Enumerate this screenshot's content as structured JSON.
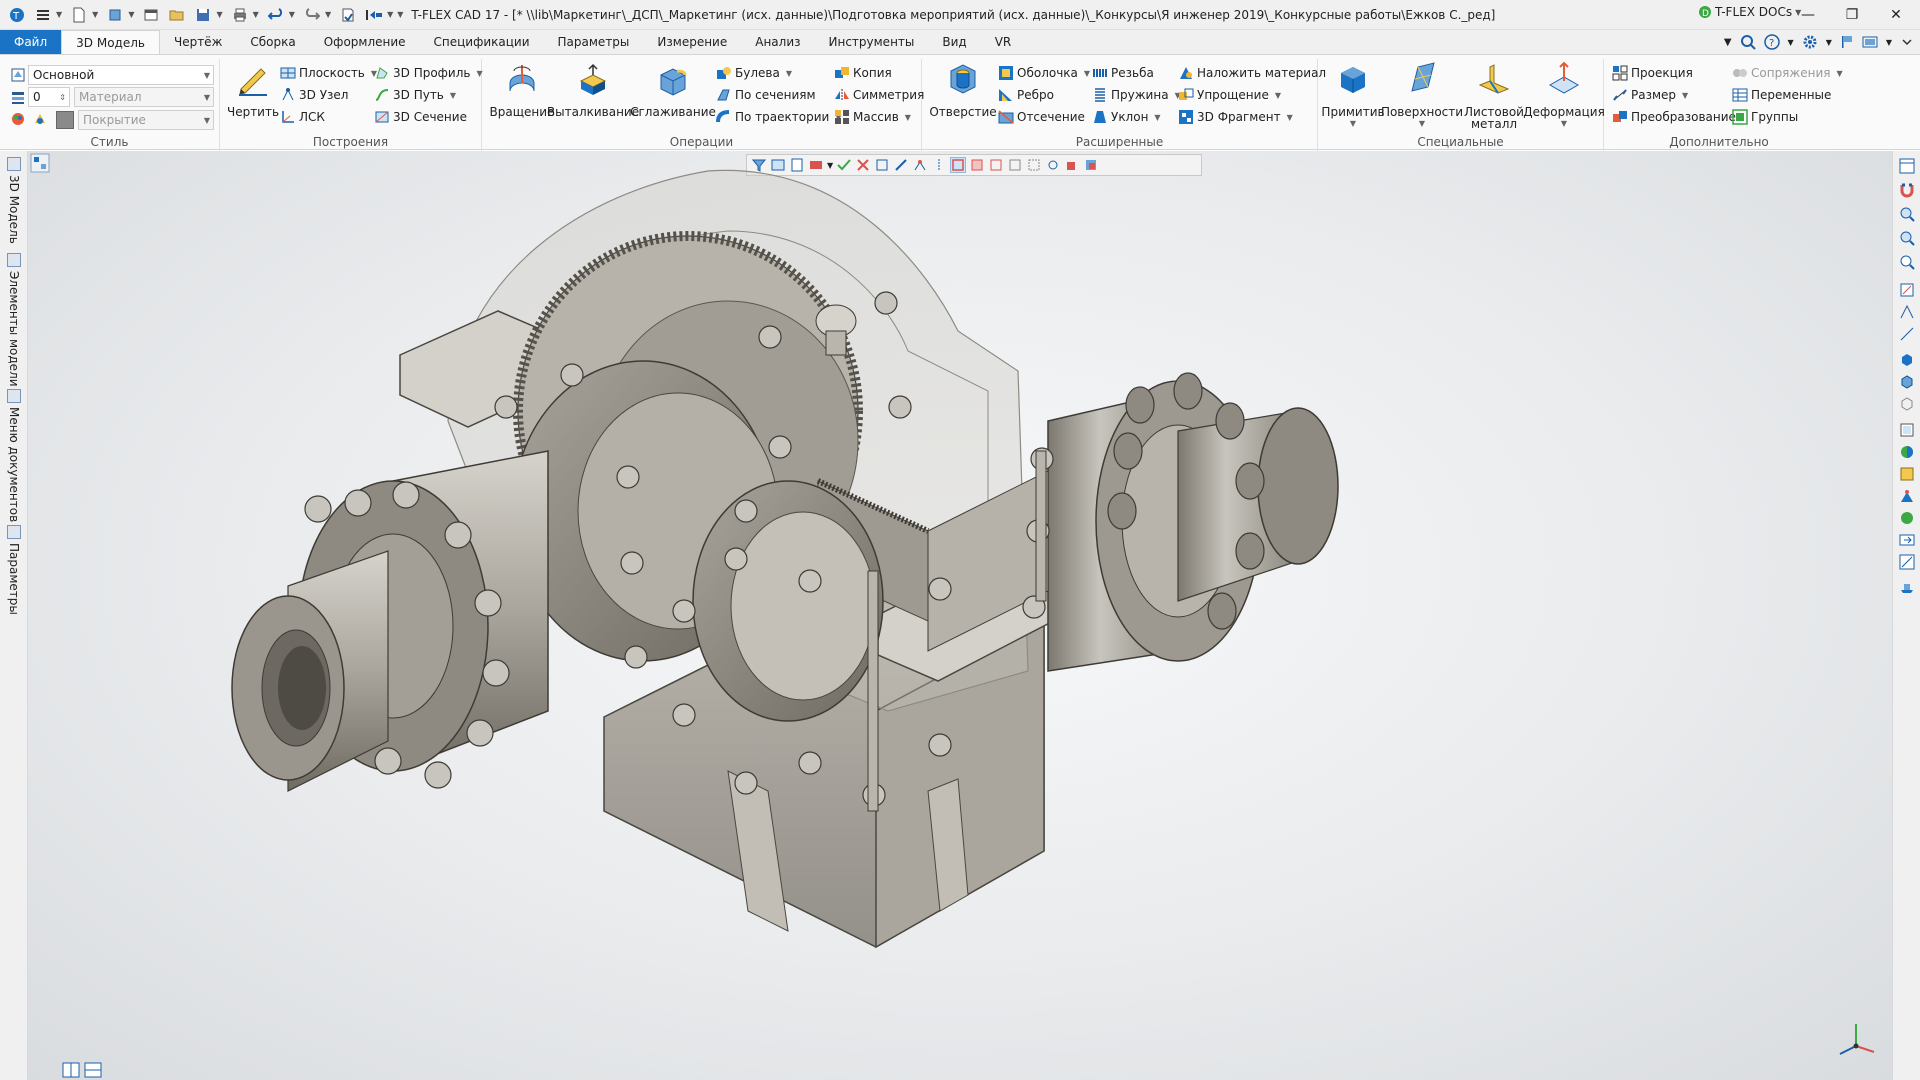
{
  "titlebar": {
    "title": "T-FLEX CAD 17 - [* \\\\lib\\Маркетинг\\_ДСП\\_Маркетинг (исх. данные)\\Подготовка мероприятий (исх. данные)\\_Конкурсы\\Я инженер 2019\\_Конкурсные работы\\Ежков С._ред]",
    "docs_label": "T-FLEX DOCs"
  },
  "tabs": [
    {
      "label": "Файл"
    },
    {
      "label": "3D Модель"
    },
    {
      "label": "Чертёж"
    },
    {
      "label": "Сборка"
    },
    {
      "label": "Оформление"
    },
    {
      "label": "Спецификации"
    },
    {
      "label": "Параметры"
    },
    {
      "label": "Измерение"
    },
    {
      "label": "Анализ"
    },
    {
      "label": "Инструменты"
    },
    {
      "label": "Вид"
    },
    {
      "label": "VR"
    }
  ],
  "ribbon": {
    "style": {
      "label": "Стиль",
      "layer": "Основной",
      "level": "0",
      "material_placeholder": "Материал",
      "coating_placeholder": "Покрытие"
    },
    "build": {
      "label": "Построения",
      "draw": "Чертить",
      "plane": "Плоскость",
      "node3d": "3D Узел",
      "lsk": "ЛСК",
      "profile3d": "3D Профиль",
      "path3d": "3D Путь",
      "section3d": "3D Сечение"
    },
    "operations": {
      "label": "Операции",
      "rotation": "Вращение",
      "extrusion": "Выталкивание",
      "smoothing": "Сглаживание",
      "boolean": "Булева",
      "by_sections": "По сечениям",
      "by_path": "По траектории",
      "copy": "Копия",
      "symmetry": "Симметрия",
      "array": "Массив"
    },
    "extended": {
      "label": "Расширенные",
      "hole": "Отверстие",
      "shell": "Оболочка",
      "rib": "Ребро",
      "cut": "Отсечение",
      "thread": "Резьба",
      "spring": "Пружина",
      "slope": "Уклон",
      "apply_material": "Наложить материал",
      "simplify": "Упрощение",
      "fragment3d": "3D Фрагмент"
    },
    "special": {
      "label": "Специальные",
      "primitives": "Примитив",
      "surfaces": "Поверхности",
      "sheet_metal_1": "Листовой",
      "sheet_metal_2": "металл",
      "deformation": "Деформация"
    },
    "additional": {
      "label": "Дополнительно",
      "projection": "Проекция",
      "dimension": "Размер",
      "transform": "Преобразование",
      "mates": "Сопряжения",
      "variables": "Переменные",
      "groups": "Группы"
    }
  },
  "left_panel": {
    "tabs": [
      "3D Модель",
      "Элементы модели",
      "Меню документов",
      "Параметры"
    ]
  },
  "colors": {
    "file_tab": "#1a73c4",
    "metal_dark": "#7f7b73",
    "metal_mid": "#a9a59d",
    "metal_light": "#d4d1ca",
    "ghost": "#c9c6bd"
  }
}
